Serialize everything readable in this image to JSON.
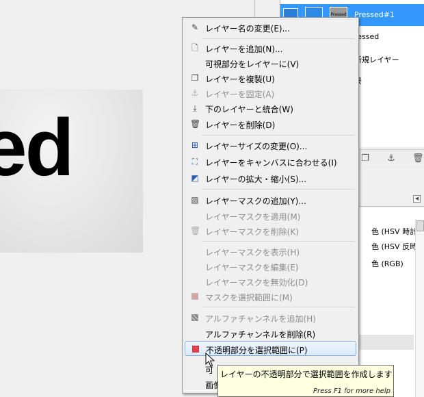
{
  "canvas": {
    "image_text": "ed"
  },
  "layers_panel": {
    "layers": [
      {
        "name": "Pressed#1",
        "thumb_text": "Pressed",
        "selected": true
      },
      {
        "name": "ressed",
        "selected": false
      },
      {
        "name": "新規レイヤー",
        "selected": false
      },
      {
        "name": "景",
        "selected": false
      }
    ],
    "toolbar_icons": [
      "duplicate-icon",
      "anchor-icon",
      "trash-icon"
    ]
  },
  "history_panel": {
    "items": [
      "色 (HSV 時計回り)",
      "色 (HSV 反時計回",
      "色 (RGB)"
    ]
  },
  "context_menu": {
    "items": [
      {
        "label": "レイヤー名の変更(E)...",
        "icon": "edit-icon",
        "enabled": true
      },
      {
        "label": "レイヤーを追加(N)...",
        "icon": "new-page-icon",
        "enabled": true
      },
      {
        "label": "可視部分をレイヤーに(V)",
        "icon": "",
        "enabled": true
      },
      {
        "label": "レイヤーを複製(U)",
        "icon": "duplicate-icon",
        "enabled": true
      },
      {
        "label": "レイヤーを固定(A)",
        "icon": "anchor-icon",
        "enabled": false
      },
      {
        "label": "下のレイヤーと統合(W)",
        "icon": "merge-down-icon",
        "enabled": true
      },
      {
        "label": "レイヤーを削除(D)",
        "icon": "trash-icon",
        "enabled": true
      },
      {
        "label": "レイヤーサイズの変更(O)...",
        "icon": "layer-size-icon",
        "enabled": true
      },
      {
        "label": "レイヤーをキャンバスに合わせる(I)",
        "icon": "fit-canvas-icon",
        "enabled": true
      },
      {
        "label": "レイヤーの拡大・縮小(S)...",
        "icon": "scale-icon",
        "enabled": true
      },
      {
        "label": "レイヤーマスクの追加(Y)...",
        "icon": "add-mask-icon",
        "enabled": true
      },
      {
        "label": "レイヤーマスクを適用(M)",
        "icon": "",
        "enabled": false
      },
      {
        "label": "レイヤーマスクを削除(K)",
        "icon": "trash-icon",
        "enabled": false
      },
      {
        "label": "レイヤーマスクを表示(H)",
        "icon": "",
        "enabled": false
      },
      {
        "label": "レイヤーマスクを編集(E)",
        "icon": "",
        "enabled": false
      },
      {
        "label": "レイヤーマスクを無効化(D)",
        "icon": "",
        "enabled": false
      },
      {
        "label": "マスクを選択範囲に(M)",
        "icon": "mask-to-selection-icon",
        "enabled": false
      },
      {
        "label": "アルファチャンネルを追加(H)",
        "icon": "alpha-icon",
        "enabled": false
      },
      {
        "label": "アルファチャンネルを削除(R)",
        "icon": "",
        "enabled": true
      },
      {
        "label": "不透明部分を選択範囲に(P)",
        "icon": "alpha-to-selection-icon",
        "enabled": true,
        "hovered": true
      },
      {
        "label": "可",
        "icon": "",
        "enabled": true
      },
      {
        "label": "画像",
        "icon": "",
        "enabled": true
      }
    ]
  },
  "tooltip": {
    "text": "レイヤーの不透明部分で選択範囲を作成します",
    "help": "Press F1 for more help"
  },
  "colors": {
    "selection_blue": "#3399ff",
    "menu_bg": "#f0f0f0",
    "tooltip_bg": "#ffffe1",
    "red_icon": "#e8424f"
  }
}
